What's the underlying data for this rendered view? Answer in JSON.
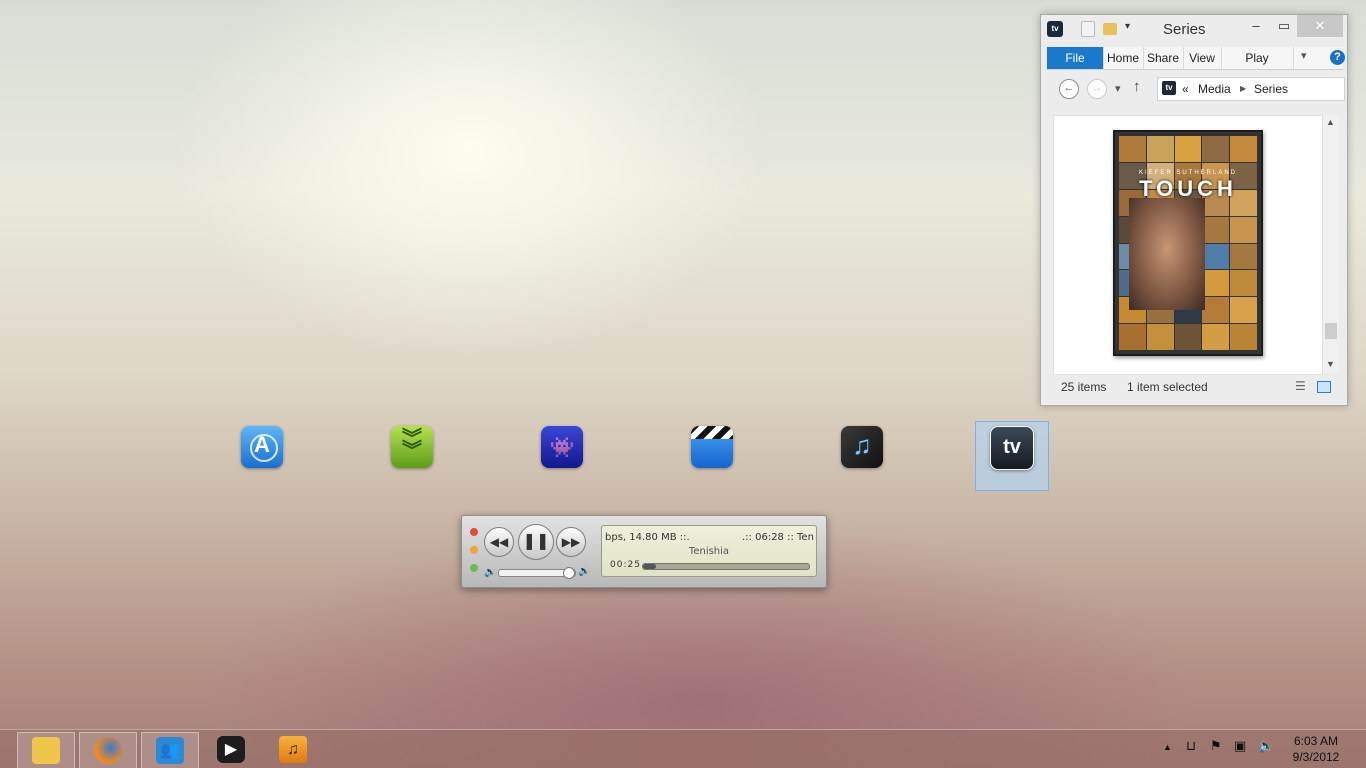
{
  "explorer": {
    "title": "Series",
    "ribbon_tabs": [
      "File",
      "Home",
      "Share",
      "View",
      "Play"
    ],
    "help_glyph": "?",
    "address": {
      "chevron": "«",
      "crumbs": [
        "Media",
        "Series"
      ]
    },
    "poster": {
      "actor": "KIEFER SUTHERLAND",
      "title": "TOUCH"
    },
    "status": {
      "items": "25 items",
      "selected": "1 item selected"
    },
    "icons": [
      "tv-app-icon",
      "properties-icon",
      "new-folder-icon",
      "back-arrow-icon",
      "forward-arrow-icon",
      "up-arrow-icon",
      "details-view-icon",
      "large-icons-view-icon"
    ]
  },
  "dock": {
    "icons": [
      "app-store-icon",
      "download-chevrons-icon",
      "space-invader-icon",
      "clapperboard-icon",
      "music-note-icon",
      "tv-icon"
    ],
    "tv_label": "tv"
  },
  "player": {
    "info_left": "bps, 14.80 MB ::.",
    "info_right": ".:: 06:28 :: Ten",
    "artist": "Tenishia",
    "elapsed": "00:25",
    "progress_fraction": 0.08,
    "volume_fraction": 0.92,
    "colors": {
      "close": "#e04a3c",
      "minimize": "#e6a93a",
      "zoom": "#6cbd45"
    }
  },
  "taskbar": {
    "apps": [
      "file-explorer-icon",
      "firefox-icon",
      "windows-live-messenger-icon",
      "media-player-icon",
      "itunes-icon"
    ]
  },
  "tray": {
    "time": "6:03 AM",
    "date": "9/3/2012"
  }
}
